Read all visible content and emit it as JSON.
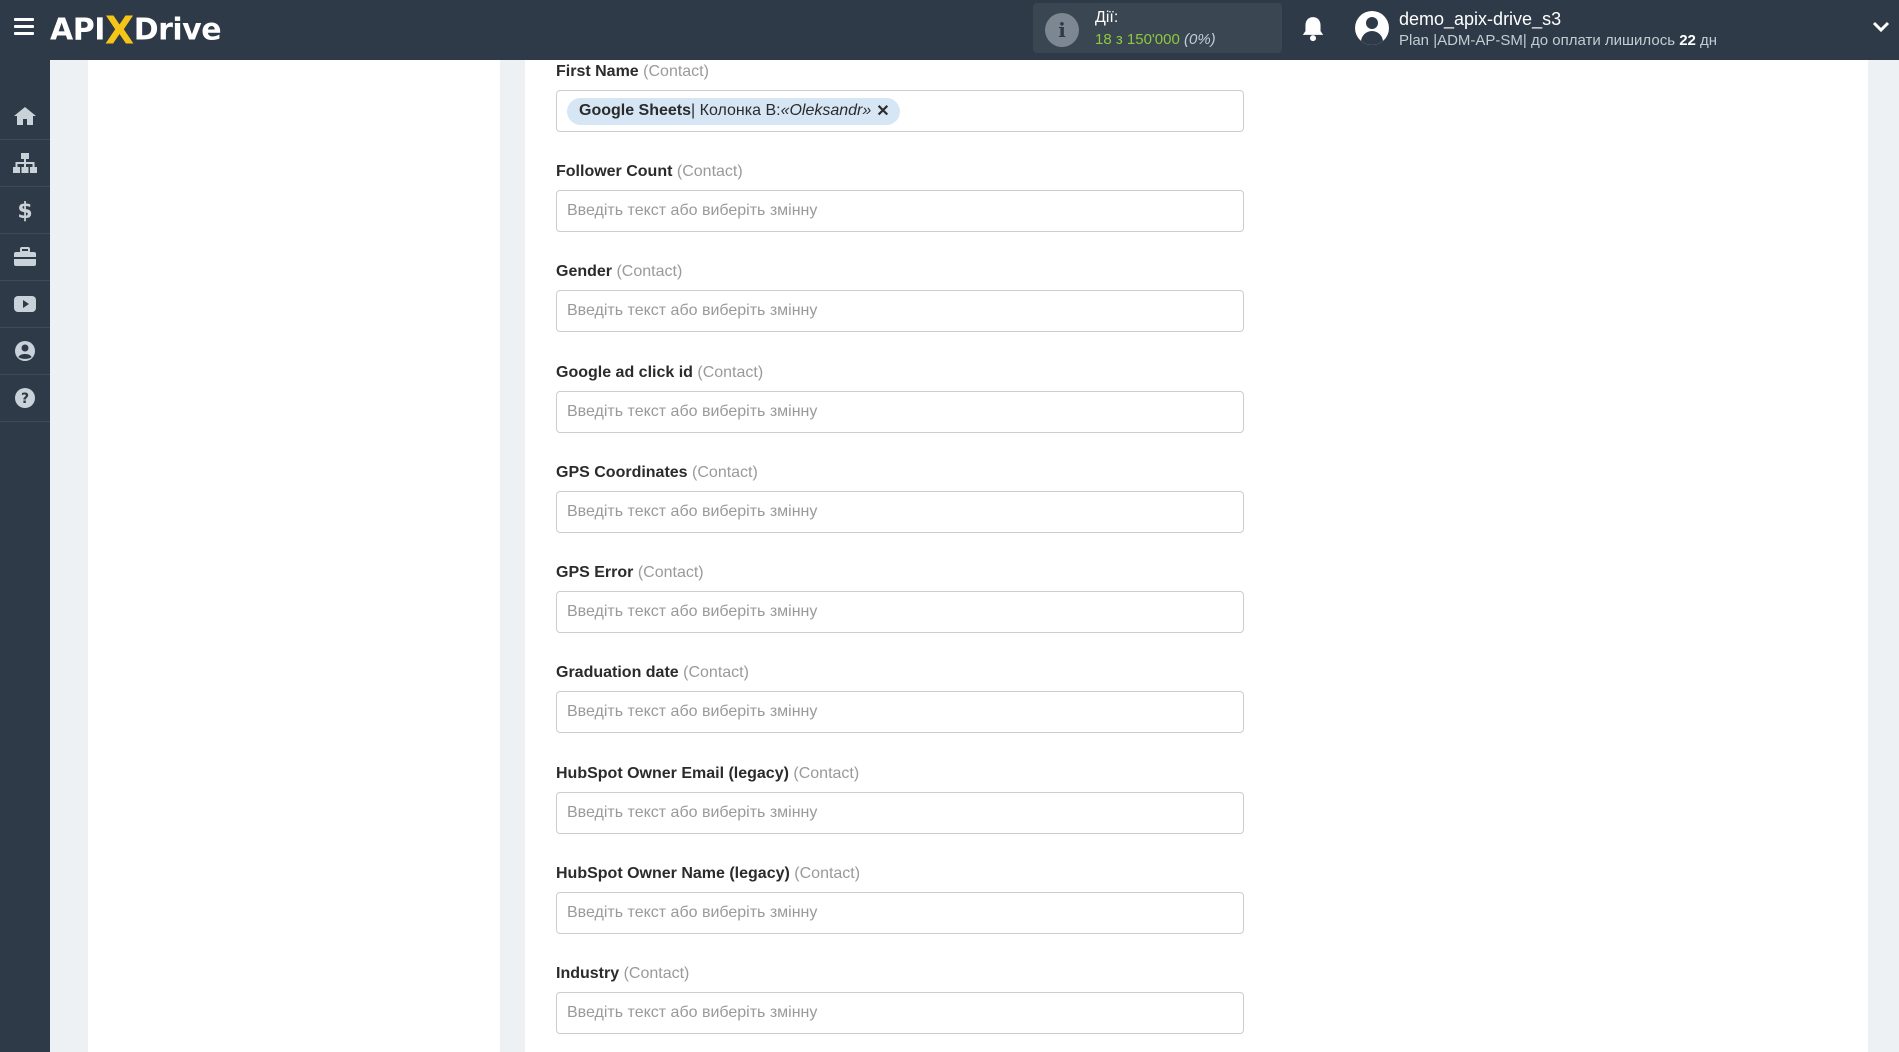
{
  "header": {
    "logo_prefix": "API",
    "logo_x": "X",
    "logo_suffix": "Drive",
    "actions_label": "Дії:",
    "actions_value": "18 з 150'000",
    "actions_percent": "(0%)",
    "username": "demo_apix-drive_s3",
    "plan_prefix": "Plan |ADM-AP-SM| до оплати лишилось ",
    "plan_days": "22",
    "plan_suffix": " дн"
  },
  "sidebar": {
    "items": [
      {
        "icon": "home-icon"
      },
      {
        "icon": "sitemap-icon"
      },
      {
        "icon": "dollar-icon"
      },
      {
        "icon": "briefcase-icon"
      },
      {
        "icon": "youtube-icon"
      },
      {
        "icon": "user-icon"
      },
      {
        "icon": "help-icon"
      }
    ]
  },
  "form": {
    "placeholder": "Введіть текст або виберіть змінну",
    "context": "(Contact)",
    "fields": [
      {
        "label": "First Name",
        "tag": {
          "source": "Google Sheets",
          "column": " | Колонка B: ",
          "value": "«Oleksandr»",
          "remove": "✕"
        }
      },
      {
        "label": "Follower Count"
      },
      {
        "label": "Gender"
      },
      {
        "label": "Google ad click id"
      },
      {
        "label": "GPS Coordinates"
      },
      {
        "label": "GPS Error"
      },
      {
        "label": "Graduation date"
      },
      {
        "label": "HubSpot Owner Email (legacy)"
      },
      {
        "label": "HubSpot Owner Name (legacy)"
      },
      {
        "label": "Industry"
      }
    ]
  },
  "colors": {
    "topbar": "#2e3a47",
    "accent_yellow": "#f5c518",
    "actions_green": "#8fc83f",
    "tag_bg": "#d7e6f5"
  }
}
